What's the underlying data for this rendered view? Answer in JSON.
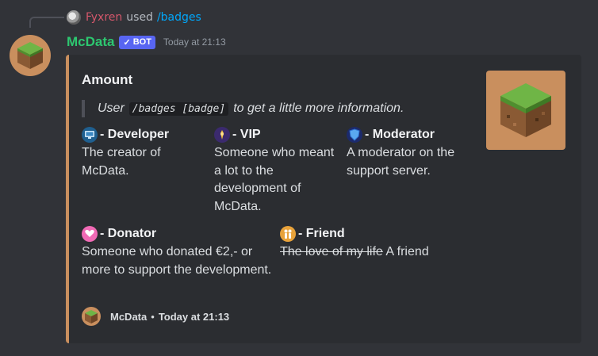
{
  "reply": {
    "username": "Fyxren",
    "used_text": "used",
    "command": "/badges"
  },
  "message": {
    "username": "McData",
    "bot_badge": "BOT",
    "bot_check": "✓",
    "timestamp": "Today at 21:13"
  },
  "embed": {
    "title": "Amount",
    "accent_color": "#c98f5e",
    "quote": {
      "before": "User",
      "code": "/badges [badge]",
      "after": "to get a little more information."
    },
    "fields": [
      {
        "icon": "monitor-icon",
        "name": "- Developer",
        "value": "The creator of McData."
      },
      {
        "icon": "crown-icon",
        "name": "- VIP",
        "value": "Someone who meant a lot to the development of McData."
      },
      {
        "icon": "shield-icon",
        "name": "- Moderator",
        "value": "A moderator on the support server."
      },
      {
        "icon": "heart-hand-icon",
        "name": "- Donator",
        "value": "Someone who donated €2,- or more to support the development."
      },
      {
        "icon": "friends-icon",
        "name": "- Friend",
        "value_strike": "The love of my life",
        "value": "A friend"
      }
    ],
    "footer": {
      "text": "McData",
      "separator": "•",
      "timestamp": "Today at 21:13"
    }
  }
}
